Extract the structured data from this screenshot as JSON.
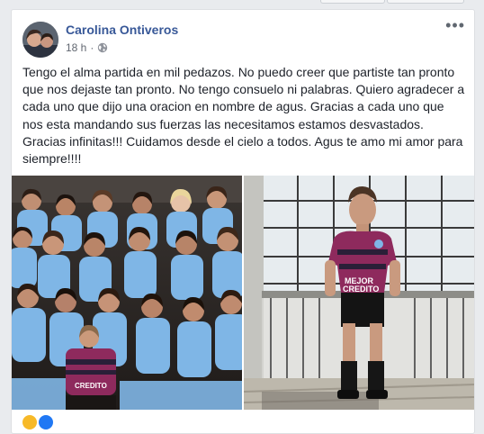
{
  "post": {
    "author": "Carolina Ontiveros",
    "time": "18 h",
    "separator": "·",
    "privacy_icon": "globe-icon",
    "more_icon": "more-options-icon",
    "more_label": "•••",
    "text": "Tengo el alma partida en mil pedazos. No puedo creer que partiste tan pronto que nos dejaste tan pronto. No tengo consuelo ni palabras. Quiero agradecer a cada uno que dijo una oracion en nombre de agus. Gracias a cada uno que nos esta mandando sus fuerzas las necesitamos estamos desvastados. Gracias infinitas!!! Cuidamos desde el cielo a todos. Agus te amo mi amor para siempre!!!!",
    "images": {
      "left": {
        "alt": "team-photo",
        "shirt_text": "CREDITO"
      },
      "right": {
        "alt": "player-photo",
        "shirt_text_1": "MEJOR",
        "shirt_text_2": "CREDITO"
      }
    }
  },
  "colors": {
    "link": "#385898",
    "text": "#1d2129",
    "meta": "#616770",
    "background": "#e9ebee",
    "jersey_blue": "#7fb6e6",
    "jersey_magenta": "#8e2a5d"
  }
}
